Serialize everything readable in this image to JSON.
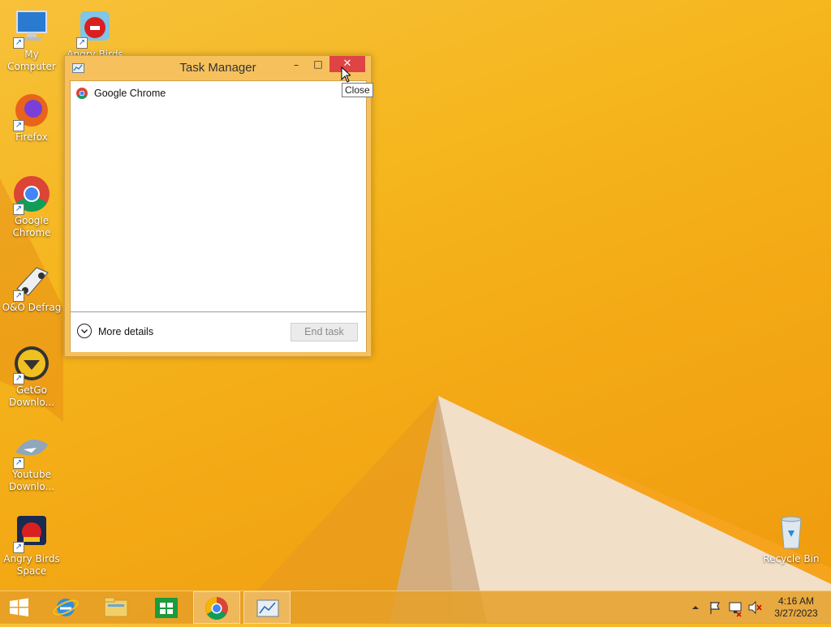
{
  "desktop": {
    "icons": [
      {
        "label": "My Computer",
        "icon": "computer-icon"
      },
      {
        "label": "Angry Birds",
        "icon": "angry-birds-icon"
      },
      {
        "label": "Firefox",
        "icon": "firefox-icon"
      },
      {
        "label": "Google Chrome",
        "icon": "chrome-icon"
      },
      {
        "label": "O&O Defrag",
        "icon": "defrag-icon"
      },
      {
        "label": "GetGo Downlo...",
        "icon": "getgo-icon"
      },
      {
        "label": "Youtube Downlo...",
        "icon": "youtube-downloader-icon"
      },
      {
        "label": "Angry Birds Space",
        "icon": "angry-birds-space-icon"
      },
      {
        "label": "Recycle Bin",
        "icon": "recycle-bin-icon"
      }
    ]
  },
  "window": {
    "title": "Task Manager",
    "buttons": {
      "minimize": "–",
      "maximize": "□",
      "close": "✕"
    },
    "processes": [
      {
        "name": "Google Chrome",
        "icon": "chrome-icon"
      }
    ],
    "footer": {
      "more_details": "More details",
      "end_task": "End task"
    }
  },
  "tooltip": {
    "text": "Close"
  },
  "taskbar": {
    "items": [
      "start-icon",
      "internet-explorer-icon",
      "file-explorer-icon",
      "store-icon",
      "chrome-icon",
      "task-manager-icon"
    ],
    "tray_icons": [
      "show-hidden-icons",
      "action-center-flag-icon",
      "network-icon",
      "volume-muted-icon"
    ],
    "time": "4:16 AM",
    "date": "3/27/2023"
  },
  "colors": {
    "accent": "#f5b51c",
    "close_red": "#e04343",
    "window_frame": "#f6c15d"
  }
}
